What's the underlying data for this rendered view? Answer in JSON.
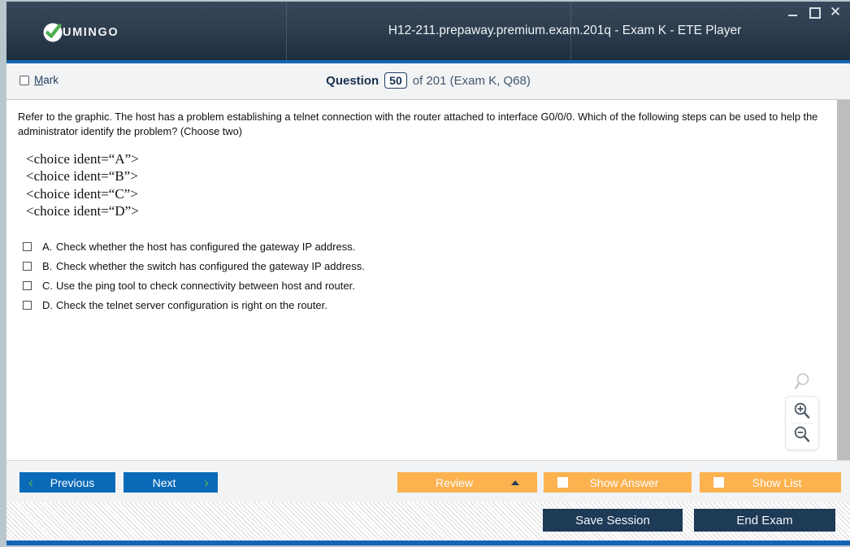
{
  "window": {
    "title": "H12-211.prepaway.premium.exam.201q - Exam K - ETE Player",
    "logo_text": "UMINGO",
    "controls": {
      "minimize": "–",
      "maximize": "□",
      "close": "✕"
    }
  },
  "question_header": {
    "mark_label_accel": "M",
    "mark_label_rest": "ark",
    "question_word": "Question",
    "question_number": "50",
    "of_text": "of 201 (Exam K, Q68)"
  },
  "question": {
    "text": "Refer to the graphic. The host has a problem establishing a telnet connection with the router attached to interface G0/0/0. Which of the following steps can be used to help the administrator identify the problem? (Choose two)",
    "ident_lines": [
      "<choice ident=“A”>",
      "<choice ident=“B”>",
      "<choice ident=“C”>",
      "<choice ident=“D”>"
    ],
    "options": [
      {
        "letter": "A.",
        "text": "Check whether the host has configured the gateway IP address.",
        "checked": false
      },
      {
        "letter": "B.",
        "text": "Check whether the switch has configured the gateway IP address.",
        "checked": false
      },
      {
        "letter": "C.",
        "text": "Use the ping tool to check connectivity between host and router.",
        "checked": false
      },
      {
        "letter": "D.",
        "text": "Check the telnet server configuration is right on the router.",
        "checked": false
      }
    ]
  },
  "zoom_controls": {
    "magnifier": "magnifier-icon",
    "zoom_in": "zoom-in-icon",
    "zoom_out": "zoom-out-icon"
  },
  "toolbar": {
    "previous_label": "Previous",
    "next_label": "Next",
    "previous_chevron": "‹",
    "next_chevron": "›",
    "review_label": "Review",
    "show_answer_label": "Show Answer",
    "show_list_label": "Show List"
  },
  "footer": {
    "save_session_label": "Save Session",
    "end_exam_label": "End Exam"
  },
  "colors": {
    "titlebar_dark": "#2e3e4f",
    "accent_blue": "#1565b5",
    "nav_blue": "#0a6ab8",
    "orange": "#fcb24f",
    "dark_navy": "#1d3a57",
    "green_check": "#4caf50",
    "chevron_green": "#5dbb46"
  }
}
